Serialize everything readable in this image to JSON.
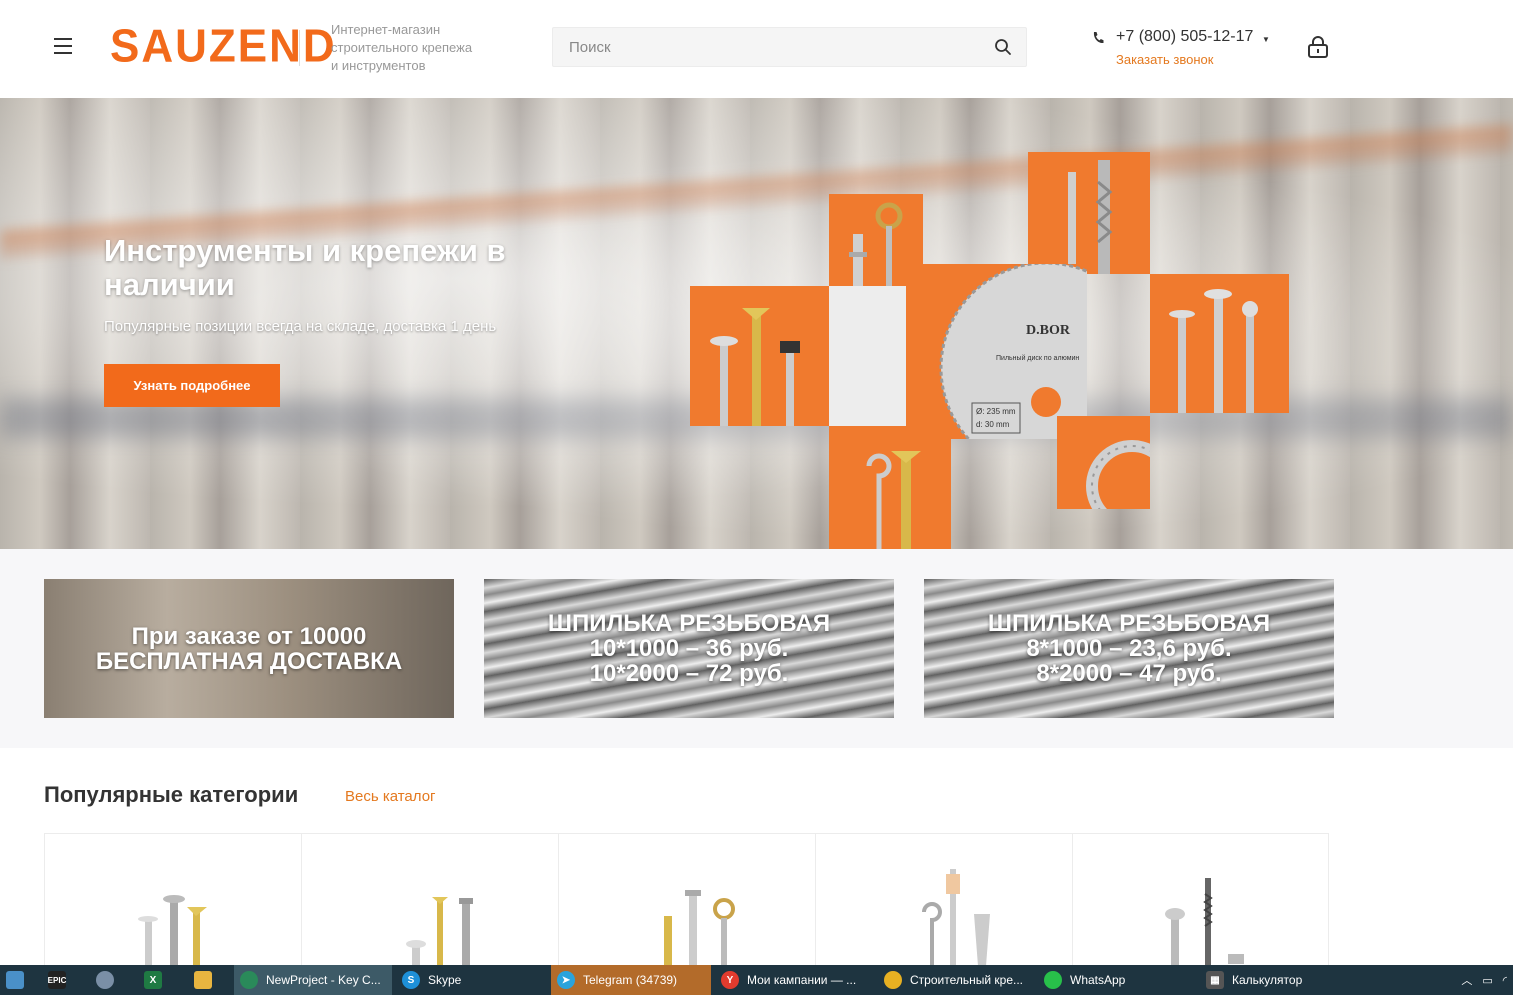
{
  "header": {
    "logo": "SAUZEND",
    "tagline": [
      "Интернет-магазин",
      "строительного крепежа",
      "и инструментов"
    ],
    "search_placeholder": "Поиск",
    "phone": "+7 (800) 505-12-17",
    "callback": "Заказать звонок"
  },
  "hero": {
    "title": "Инструменты и крепежи в наличии",
    "subtitle": "Популярные позиции всегда на складе,  доставка 1 день",
    "button": "Узнать подробнее",
    "disc_brand": "D.BOR",
    "disc_caption": "Пильный диск по алюмин",
    "disc_d1": "Ø: 235 mm",
    "disc_d2": "d: 30 mm"
  },
  "banners": [
    {
      "lines": [
        "При заказе от 10000",
        "БЕСПЛАТНАЯ ДОСТАВКА"
      ]
    },
    {
      "lines": [
        "ШПИЛЬКА РЕЗЬБОВАЯ",
        "10*1000 – 36 руб.",
        "10*2000 – 72 руб."
      ]
    },
    {
      "lines": [
        "ШПИЛЬКА РЕЗЬБОВАЯ",
        "8*1000 – 23,6 руб.",
        "8*2000 – 47 руб."
      ]
    }
  ],
  "categories": {
    "title": "Популярные категории",
    "link": "Весь каталог"
  },
  "taskbar": {
    "items": [
      {
        "label": "NewProject - Key C...",
        "color": "#2a8a5a"
      },
      {
        "label": "Skype",
        "color": "#1e90d8"
      },
      {
        "label": "Telegram (34739)",
        "color": "#2aa3dc"
      },
      {
        "label": "Мои кампании — ...",
        "color": "#e23b2e"
      },
      {
        "label": "Строительный кре...",
        "color": "#e7b022"
      },
      {
        "label": "WhatsApp",
        "color": "#28c04a"
      },
      {
        "label": "Калькулятор",
        "color": "#555"
      }
    ],
    "pinned": [
      "EPIC"
    ]
  },
  "colors": {
    "accent": "#f26a1b",
    "link": "#e4791f",
    "taskbar": "#1e3440"
  }
}
